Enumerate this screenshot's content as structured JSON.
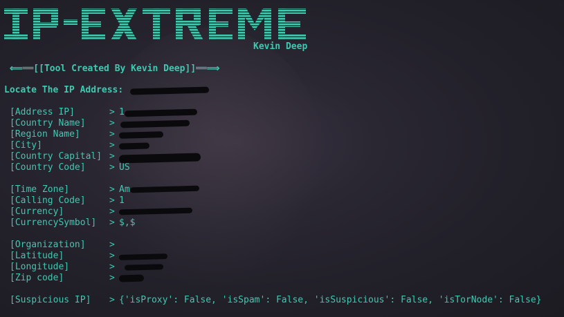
{
  "banner": {
    "title": "IP-EXTREME",
    "author": "Kevin Deep"
  },
  "tagline": "⟸══[[Tool Created By Kevin Deep]]══⟹",
  "locate": {
    "label": "Locate The IP Address:",
    "value": ""
  },
  "colors": {
    "accent": "#3fc9b0",
    "background": "#24222b",
    "redaction": "#0a0a0c"
  },
  "fields": [
    {
      "key": "[Address IP]",
      "value": "1"
    },
    {
      "key": "[Country Name]",
      "value": ""
    },
    {
      "key": "[Region Name]",
      "value": ""
    },
    {
      "key": "[City]",
      "value": ""
    },
    {
      "key": "[Country Capital]",
      "value": ""
    },
    {
      "key": "[Country Code]",
      "value": "US"
    },
    {
      "key": "[Time Zone]",
      "value": "Am"
    },
    {
      "key": "[Calling Code]",
      "value": "1"
    },
    {
      "key": "[Currency]",
      "value": ""
    },
    {
      "key": "[CurrencySymbol]",
      "value": "$,$"
    },
    {
      "key": "[Organization]",
      "value": ""
    },
    {
      "key": "[Latitude]",
      "value": ""
    },
    {
      "key": "[Longitude]",
      "value": ""
    },
    {
      "key": "[Zip code]",
      "value": ""
    },
    {
      "key": "[Suspicious IP]",
      "value": "{'isProxy': False, 'isSpam': False, 'isSuspicious': False, 'isTorNode': False}"
    }
  ],
  "arrow": ">"
}
